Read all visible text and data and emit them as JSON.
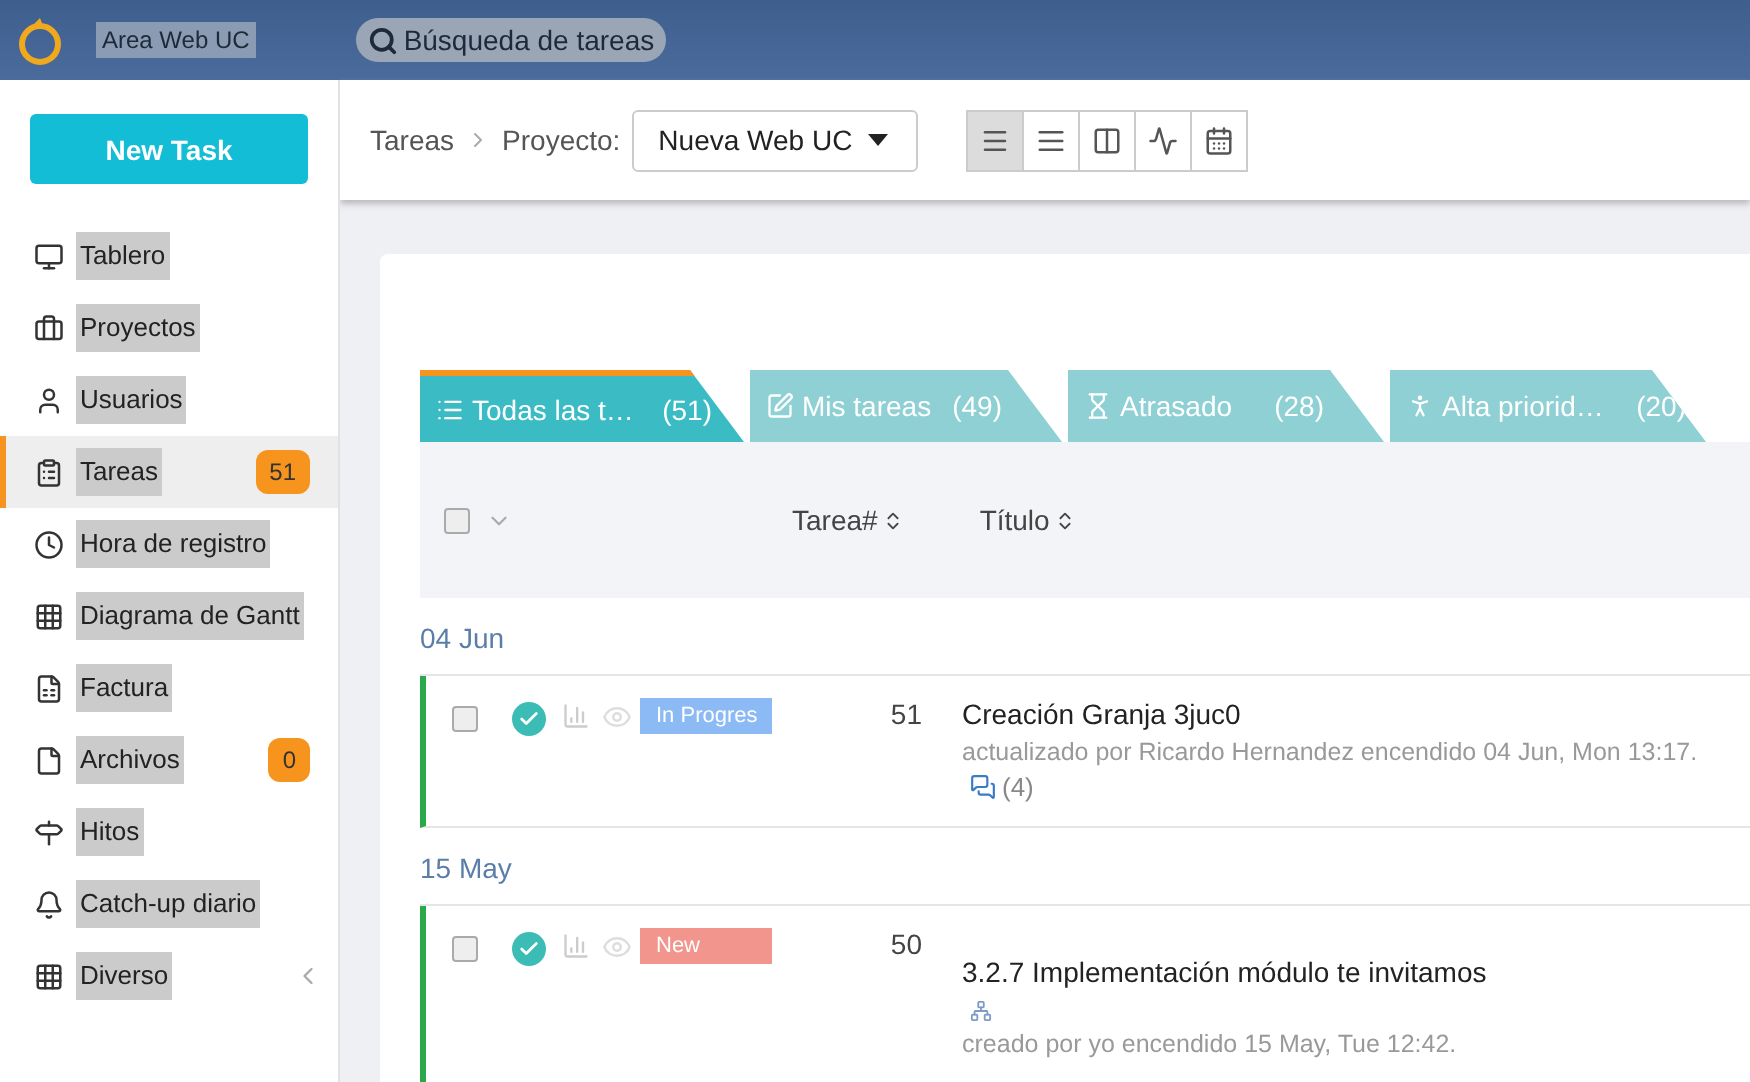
{
  "topbar": {
    "app_name": "Area Web UC",
    "search_placeholder": "Búsqueda de tareas"
  },
  "sidebar": {
    "new_task_button": "New Task",
    "items": [
      {
        "label": "Tablero",
        "selected": false
      },
      {
        "label": "Proyectos",
        "selected": false
      },
      {
        "label": "Usuarios",
        "selected": false
      },
      {
        "label": "Tareas",
        "badge": "51",
        "selected": true
      },
      {
        "label": "Hora de registro",
        "selected": false
      },
      {
        "label": "Diagrama de Gantt",
        "selected": false
      },
      {
        "label": "Factura",
        "selected": false
      },
      {
        "label": "Archivos",
        "badge": "0",
        "selected": false
      },
      {
        "label": "Hitos",
        "selected": false
      },
      {
        "label": "Catch-up diario",
        "selected": false
      },
      {
        "label": "Diverso",
        "selected": false
      }
    ]
  },
  "header": {
    "breadcrumb": "Tareas",
    "project_label": "Proyecto:",
    "project_value": "Nueva Web UC",
    "view_buttons": [
      {
        "kind": "list",
        "selected": true
      },
      {
        "kind": "compact",
        "selected": false
      },
      {
        "kind": "board",
        "selected": false
      },
      {
        "kind": "activity",
        "selected": false
      },
      {
        "kind": "calendar",
        "selected": false
      }
    ]
  },
  "tabs": [
    {
      "label": "Todas las t…",
      "count": "(51)",
      "selected": true
    },
    {
      "label": "Mis tareas",
      "count": "(49)",
      "selected": false
    },
    {
      "label": "Atrasado",
      "count": "(28)",
      "selected": false
    },
    {
      "label": "Alta priorid…",
      "count": "(20)",
      "selected": false
    }
  ],
  "table": {
    "select_all_checked": false,
    "columns": [
      "Tarea#",
      "Título"
    ],
    "groups": [
      {
        "date": "04 Jun",
        "tasks": [
          {
            "checked": false,
            "status": "In Progres",
            "color": "#8cbaf4",
            "number": "51",
            "title": "Creación Granja 3juc0",
            "meta": "actualizado por Ricardo Hernandez encendido 04 Jun, Mon 13:17.",
            "comments": "(4)",
            "kind": "commented"
          }
        ]
      },
      {
        "date": "15 May",
        "tasks": [
          {
            "checked": false,
            "status": "New",
            "color": "#f2958c",
            "number": "50",
            "title": "3.2.7 Implementación módulo te invitamos",
            "meta": "creado por yo encendido 15 May, Tue 12:42.",
            "kind": "subtask"
          }
        ]
      }
    ]
  }
}
